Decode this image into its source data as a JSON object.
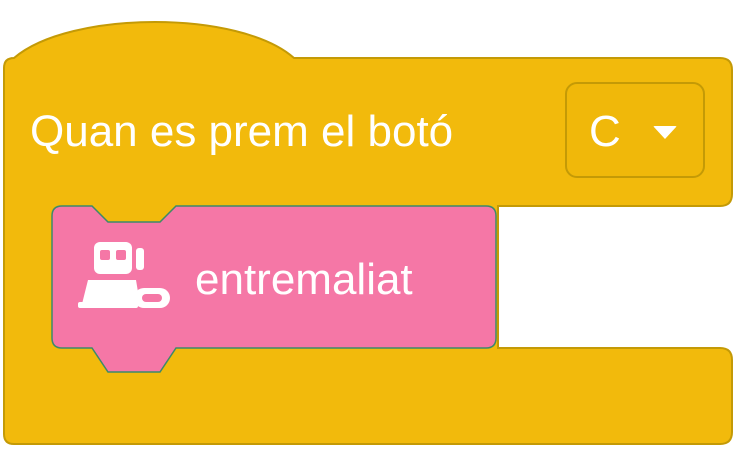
{
  "hat_block": {
    "label": "Quan es prem el botó",
    "dropdown_value": "C",
    "color": "#F2BA0C",
    "border_color": "#C49A06"
  },
  "action_block": {
    "label": "entremaliat",
    "icon": "robot-icon",
    "color": "#F577A6",
    "border_color": "#3D8A6A"
  },
  "dropdown_icon": "chevron-down-icon"
}
